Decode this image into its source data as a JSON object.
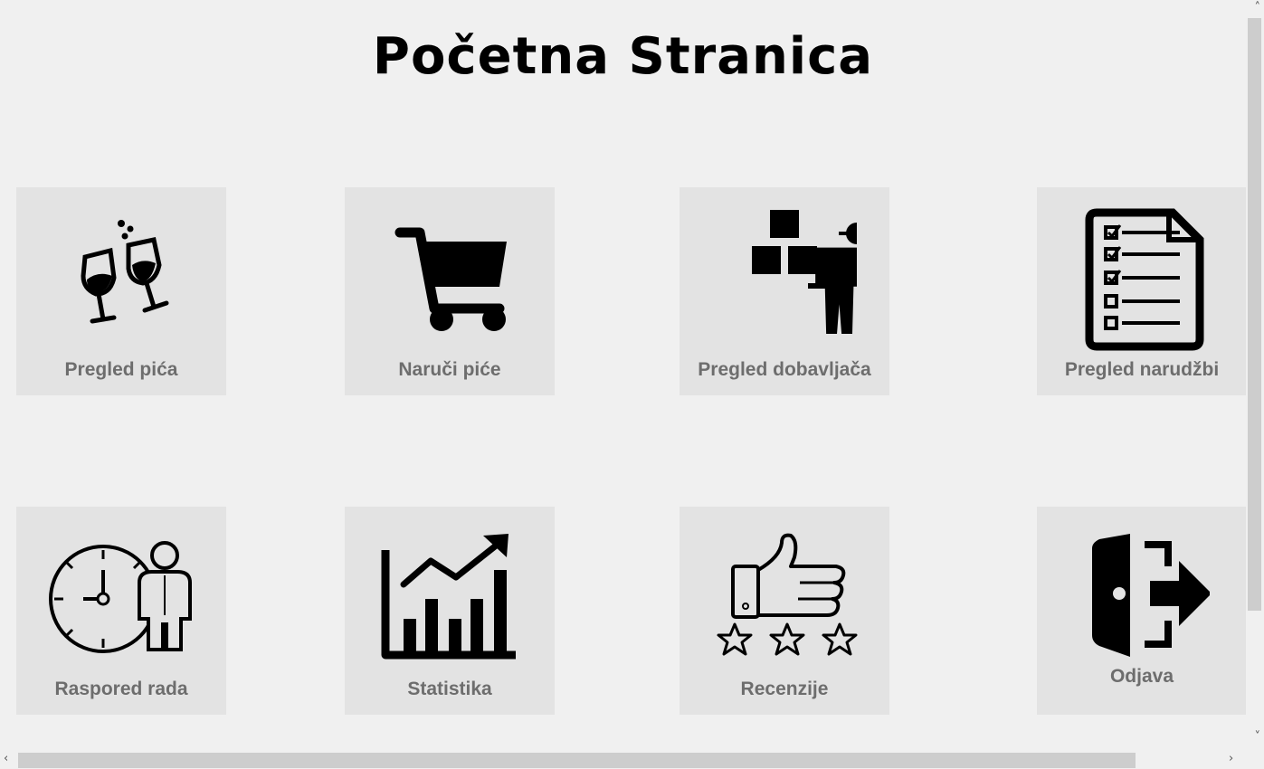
{
  "page": {
    "title": "Početna Stranica"
  },
  "tiles": [
    {
      "label": "Pregled pića",
      "icon": "wine-glasses-icon"
    },
    {
      "label": "Naruči piće",
      "icon": "shopping-cart-icon"
    },
    {
      "label": "Pregled dobavljača",
      "icon": "delivery-worker-icon"
    },
    {
      "label": "Pregled narudžbi",
      "icon": "order-checklist-icon"
    },
    {
      "label": "Raspored rada",
      "icon": "clock-employee-icon"
    },
    {
      "label": "Statistika",
      "icon": "chart-trend-icon"
    },
    {
      "label": "Recenzije",
      "icon": "thumbs-up-stars-icon"
    },
    {
      "label": "Odjava",
      "icon": "logout-door-icon"
    }
  ]
}
